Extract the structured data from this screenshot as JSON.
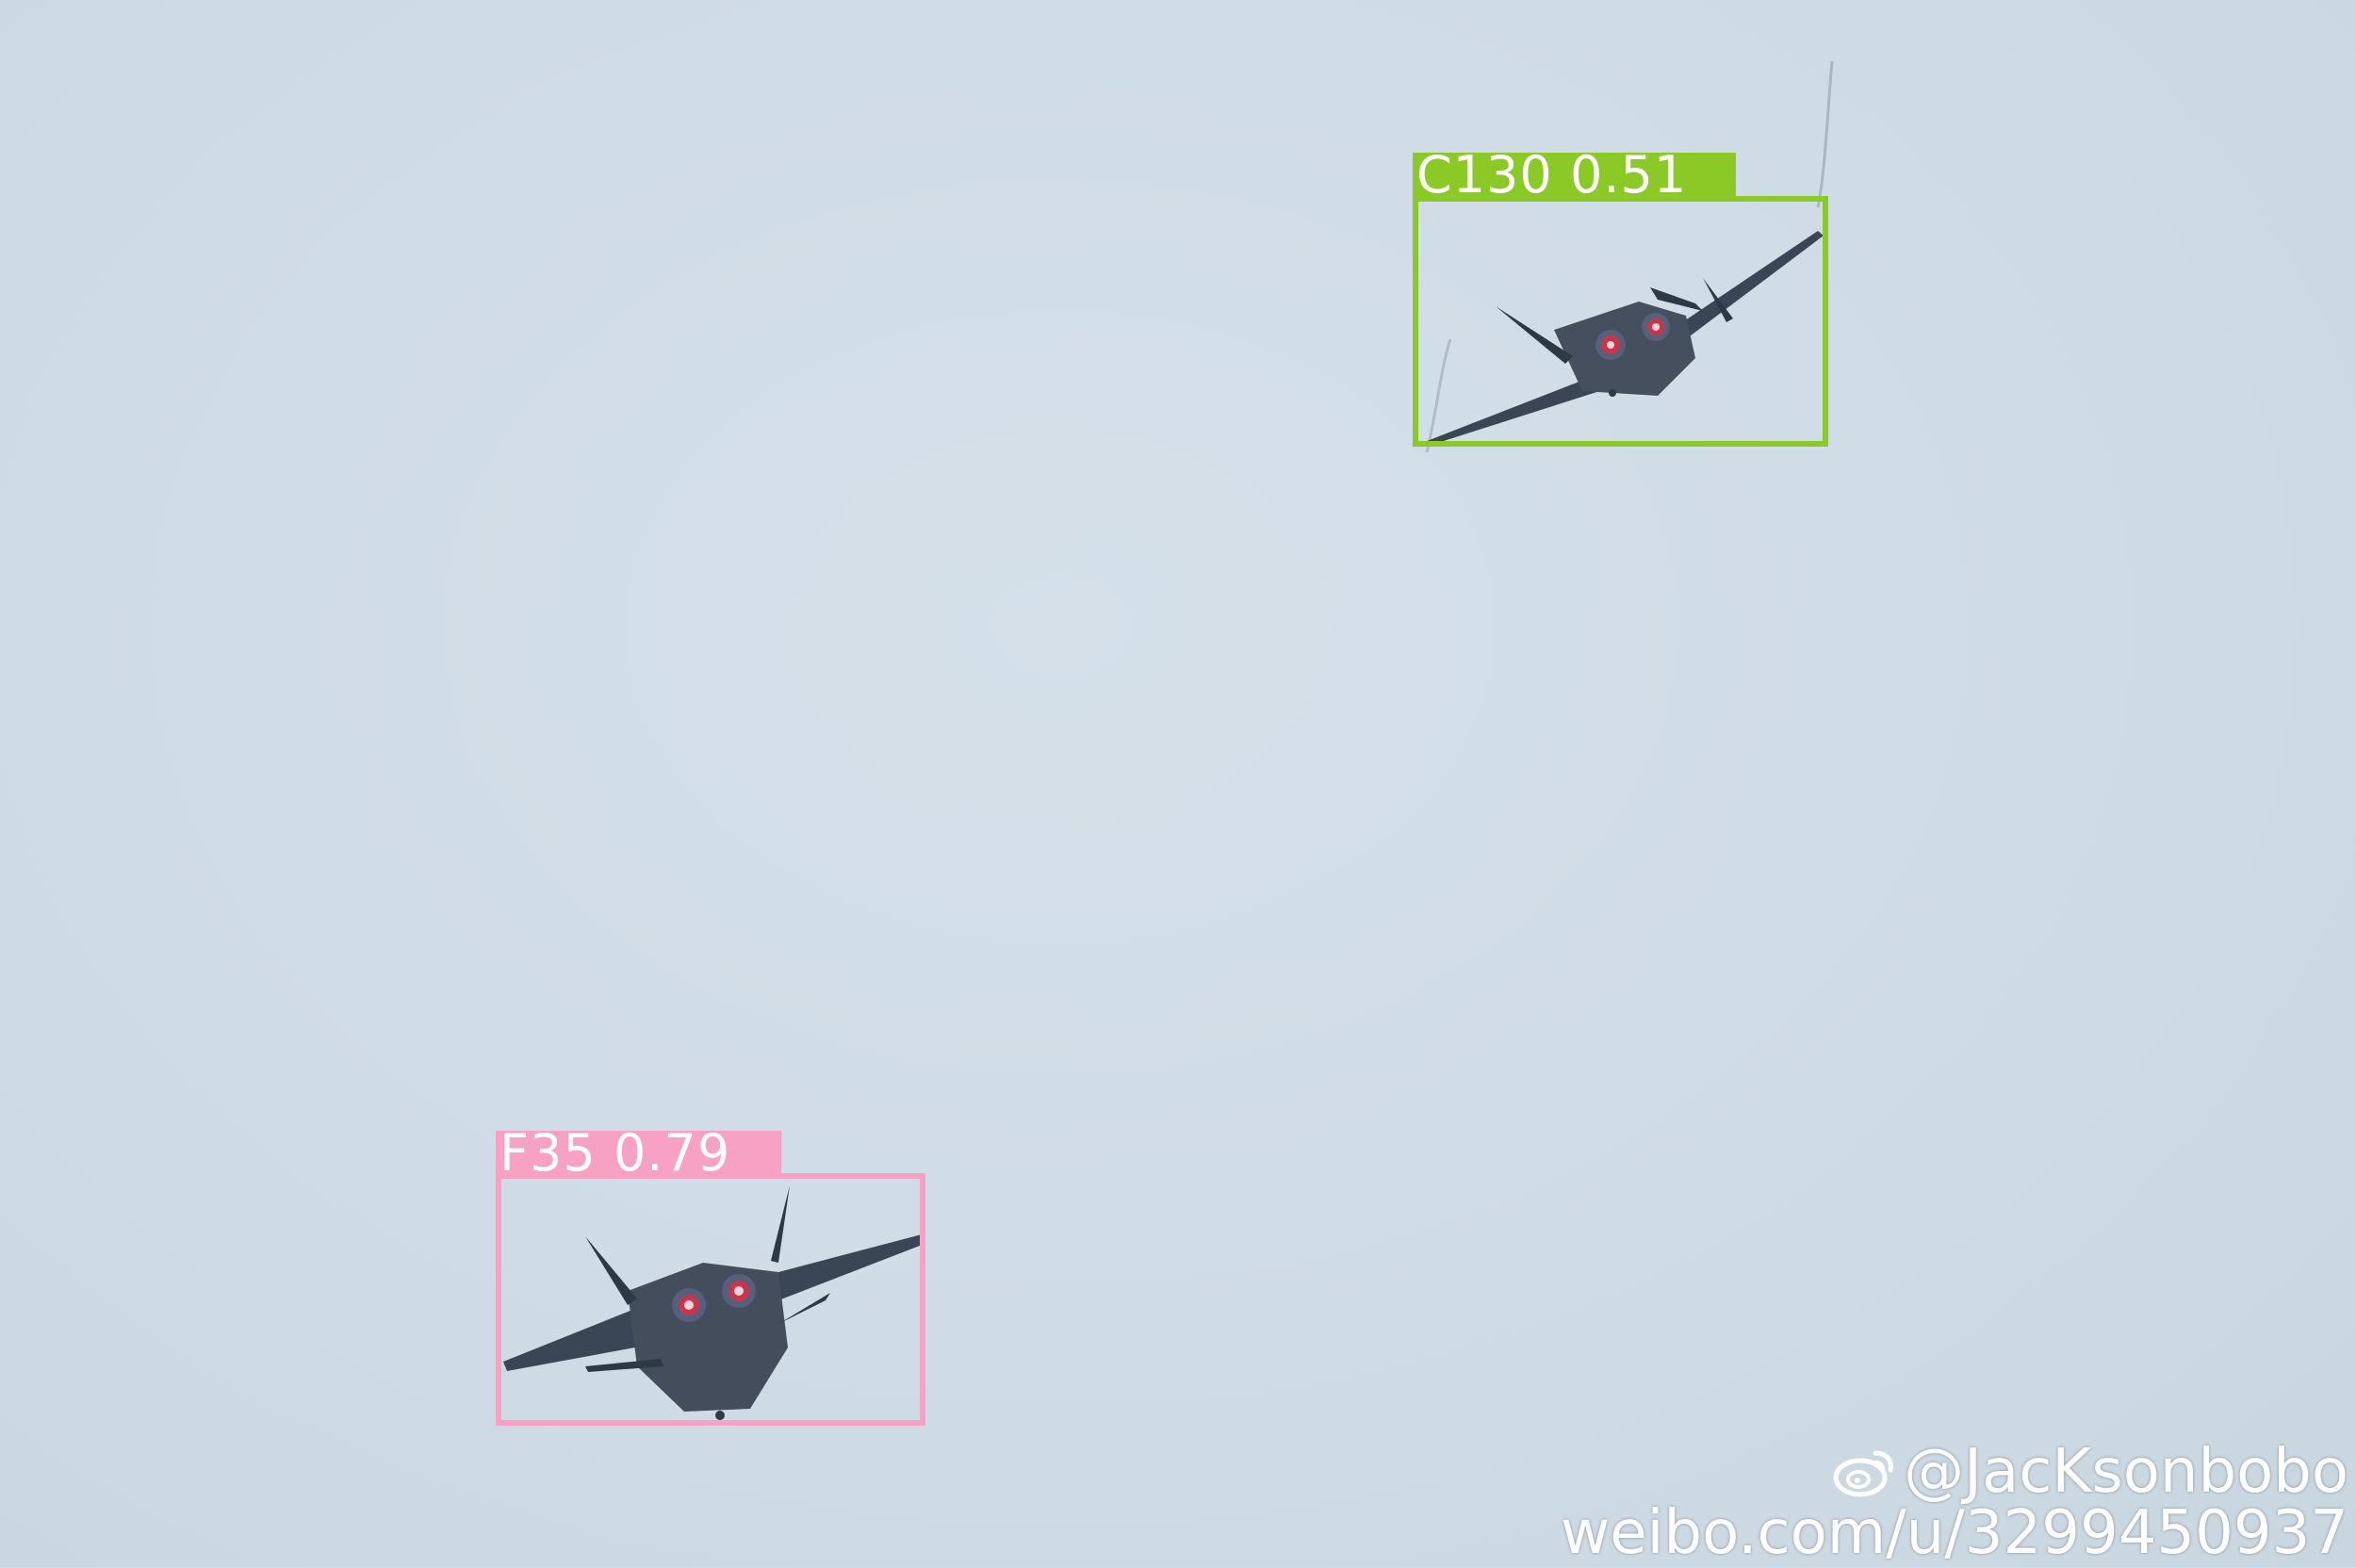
{
  "detections": [
    {
      "label": "C130 0.51",
      "class_name": "C130",
      "confidence": 0.51,
      "color": "#8ac926"
    },
    {
      "label": "F35 0.79",
      "class_name": "F35",
      "confidence": 0.79,
      "color": "#f7a1c4"
    }
  ],
  "watermark": {
    "handle": "@JacKsonbobo",
    "url": "weibo.com/u/3299450937",
    "icon": "weibo-icon"
  },
  "colors": {
    "sky": "#cfdbe5",
    "jet_body": "#3a4655",
    "afterburner": "#c9364b"
  }
}
